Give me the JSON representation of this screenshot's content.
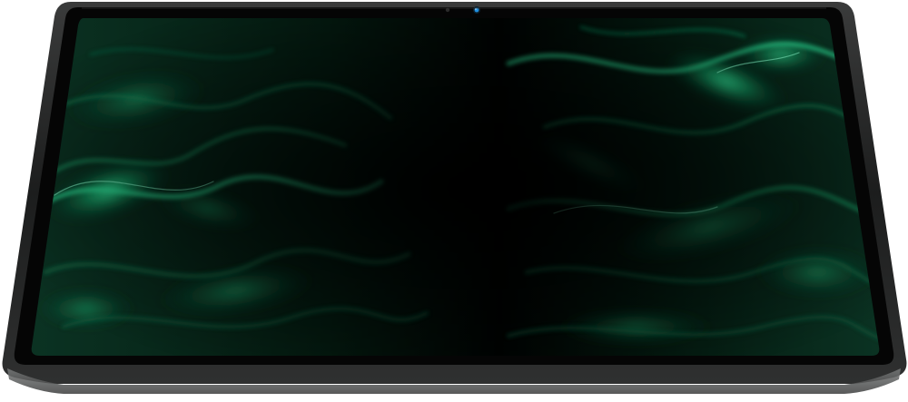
{
  "scene": {
    "subject": "tablet-front-view",
    "wallpaper": "dark-green-abstract-swirl"
  },
  "colors": {
    "background": "#ffffff",
    "frame_outer": "#2b2c2c",
    "frame_highlight": "#6a6c6c",
    "bezel": "#050505",
    "screen_base": "#020403",
    "wallpaper_glow": "#1fd18a",
    "wallpaper_mid": "#0f5a3a",
    "wallpaper_dark": "#04140d",
    "camera_lens": "#1f8fe0"
  },
  "icons": {
    "front_camera": "camera-icon",
    "ambient_sensor": "sensor-icon"
  }
}
